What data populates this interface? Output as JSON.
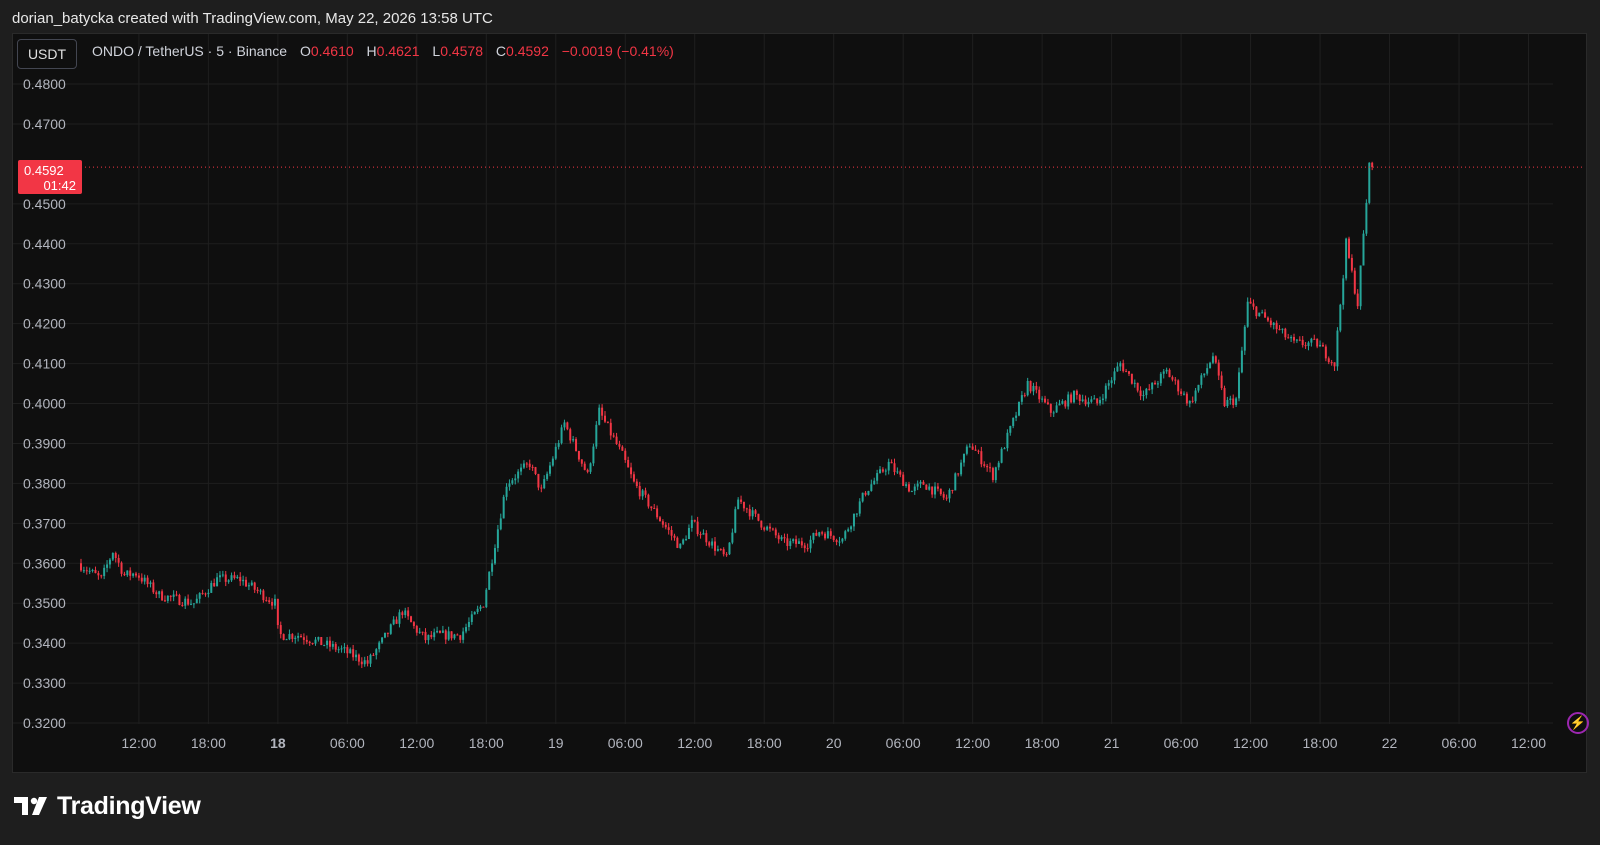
{
  "header": {
    "credit": "dorian_batycka created with TradingView.com, May 22, 2026 13:58 UTC"
  },
  "toolbar": {
    "currency": "USDT"
  },
  "legend": {
    "symbol": "ONDO / TetherUS · 5 · Binance",
    "open_label": "O",
    "open": "0.4610",
    "high_label": "H",
    "high": "0.4621",
    "low_label": "L",
    "low": "0.4578",
    "close_label": "C",
    "close": "0.4592",
    "change": "−0.0019 (−0.41%)"
  },
  "last_price": {
    "price": "0.4592",
    "countdown": "01:42"
  },
  "footer": {
    "brand": "TradingView",
    "logo_icon": "tradingview-logo-icon",
    "alert_icon": "lightning-icon"
  },
  "colors": {
    "up": "#26a69a",
    "down": "#f23645",
    "grid": "#1f1f1f",
    "background": "#0f0f0f",
    "axis_text": "#b2b5be"
  },
  "chart_data": {
    "type": "candlestick",
    "interval": "5 min",
    "ylim": [
      0.318,
      0.4885
    ],
    "y_ticks": [
      "0.3200",
      "0.3300",
      "0.3400",
      "0.3500",
      "0.3600",
      "0.3700",
      "0.3800",
      "0.3900",
      "0.4000",
      "0.4100",
      "0.4200",
      "0.4300",
      "0.4400",
      "0.4500",
      "0.4700",
      "0.4800"
    ],
    "x_ticks": [
      {
        "label": "12:00",
        "bold": false
      },
      {
        "label": "18:00",
        "bold": false
      },
      {
        "label": "18",
        "bold": true
      },
      {
        "label": "06:00",
        "bold": false
      },
      {
        "label": "12:00",
        "bold": false
      },
      {
        "label": "18:00",
        "bold": false
      },
      {
        "label": "19",
        "bold": false
      },
      {
        "label": "06:00",
        "bold": false
      },
      {
        "label": "12:00",
        "bold": false
      },
      {
        "label": "18:00",
        "bold": false
      },
      {
        "label": "20",
        "bold": false
      },
      {
        "label": "06:00",
        "bold": false
      },
      {
        "label": "12:00",
        "bold": false
      },
      {
        "label": "18:00",
        "bold": false
      },
      {
        "label": "21",
        "bold": false
      },
      {
        "label": "06:00",
        "bold": false
      },
      {
        "label": "12:00",
        "bold": false
      },
      {
        "label": "18:00",
        "bold": false
      },
      {
        "label": "22",
        "bold": false
      },
      {
        "label": "06:00",
        "bold": false
      },
      {
        "label": "12:00",
        "bold": false
      }
    ],
    "last_price_line": 0.4592,
    "path_hours": [
      0,
      2,
      3,
      4,
      5,
      7,
      10,
      12,
      14,
      17,
      17.3,
      19,
      21,
      23,
      25,
      28,
      29,
      30,
      31,
      33,
      35,
      37,
      39,
      40,
      42,
      44,
      45,
      47,
      48,
      50,
      52,
      53,
      56,
      57,
      59,
      61,
      63,
      64,
      66,
      68,
      70,
      72,
      73,
      75,
      77,
      79,
      82,
      84,
      86,
      88,
      90,
      92,
      94,
      96,
      98,
      99,
      100,
      101,
      103,
      105,
      107,
      108.5,
      109.5,
      110.5,
      111.5
    ],
    "path_values": [
      0.36,
      0.356,
      0.363,
      0.357,
      0.3575,
      0.352,
      0.35,
      0.356,
      0.356,
      0.35,
      0.342,
      0.342,
      0.34,
      0.338,
      0.335,
      0.348,
      0.344,
      0.341,
      0.342,
      0.342,
      0.35,
      0.38,
      0.385,
      0.378,
      0.395,
      0.382,
      0.398,
      0.387,
      0.38,
      0.372,
      0.364,
      0.37,
      0.361,
      0.376,
      0.37,
      0.365,
      0.365,
      0.368,
      0.366,
      0.378,
      0.385,
      0.378,
      0.38,
      0.376,
      0.39,
      0.382,
      0.405,
      0.398,
      0.402,
      0.4,
      0.41,
      0.402,
      0.408,
      0.4,
      0.412,
      0.4,
      0.401,
      0.425,
      0.42,
      0.415,
      0.415,
      0.41,
      0.44,
      0.425,
      0.4592
    ],
    "open": 0.461,
    "high": 0.4621,
    "low": 0.4578,
    "close": 0.4592
  }
}
